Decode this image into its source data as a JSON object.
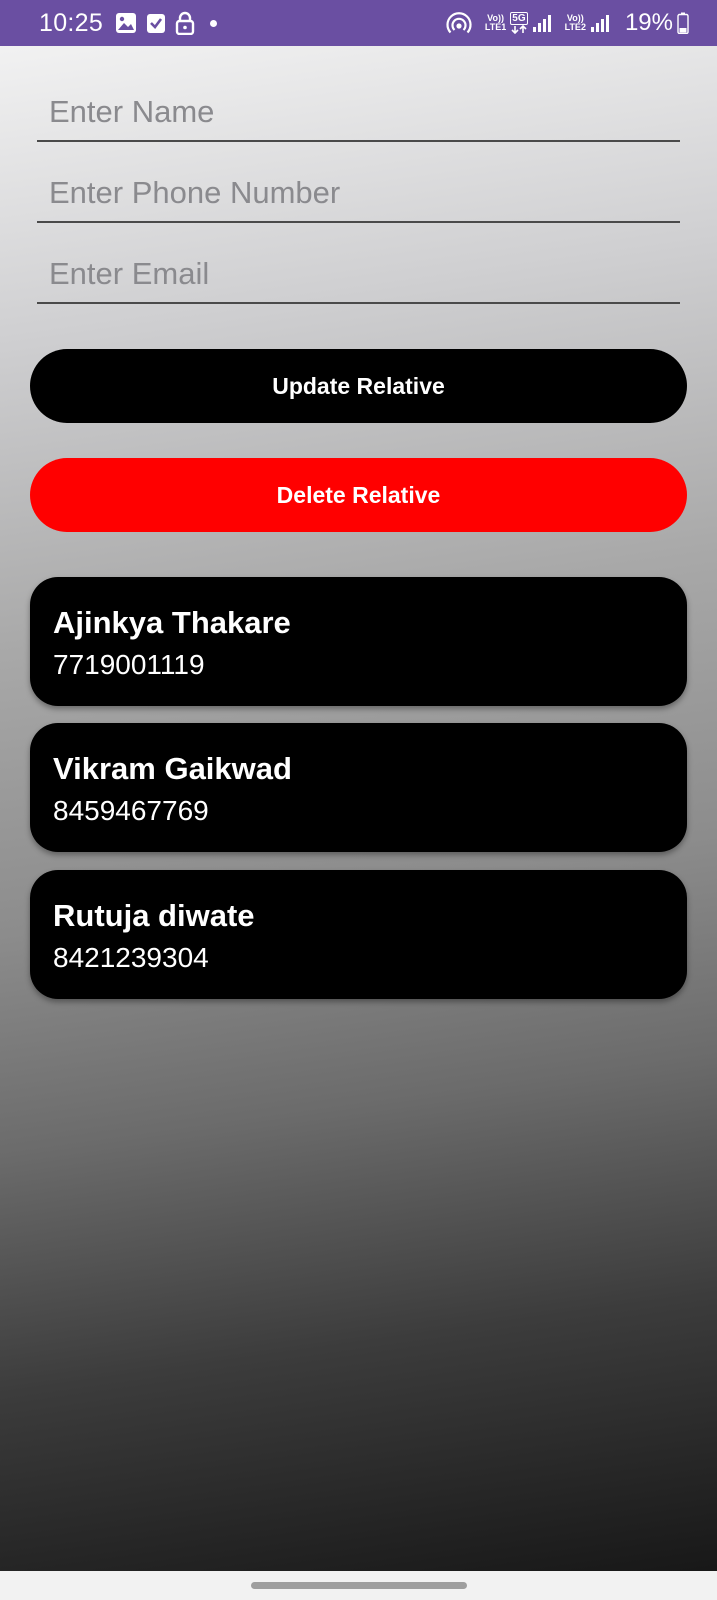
{
  "status_bar": {
    "time": "10:25",
    "icons": [
      "gallery-icon",
      "checkbox-icon",
      "lock-icon",
      "notification-dot-icon",
      "hotspot-icon",
      "volte-lte1-icon",
      "5g-data-icon",
      "signal-sim1-icon",
      "volte-lte2-icon",
      "signal-sim2-icon",
      "battery-icon"
    ],
    "volte1_top": "Vo))",
    "volte1_bottom": "LTE1",
    "net_type": "5G",
    "volte2_top": "Vo))",
    "volte2_bottom": "LTE2",
    "battery": "19%"
  },
  "form": {
    "name_placeholder": "Enter Name",
    "name_value": "",
    "phone_placeholder": "Enter Phone Number",
    "phone_value": "",
    "email_placeholder": "Enter Email",
    "email_value": ""
  },
  "buttons": {
    "update_label": "Update Relative",
    "update_color": "#000000",
    "delete_label": "Delete Relative",
    "delete_color": "#ff0000"
  },
  "relatives": [
    {
      "name": "Ajinkya Thakare",
      "phone": "7719001119"
    },
    {
      "name": "Vikram Gaikwad",
      "phone": "8459467769"
    },
    {
      "name": "Rutuja diwate",
      "phone": "8421239304"
    }
  ],
  "colors": {
    "status_bar": "#6a4fa2",
    "card_bg": "#000000"
  }
}
